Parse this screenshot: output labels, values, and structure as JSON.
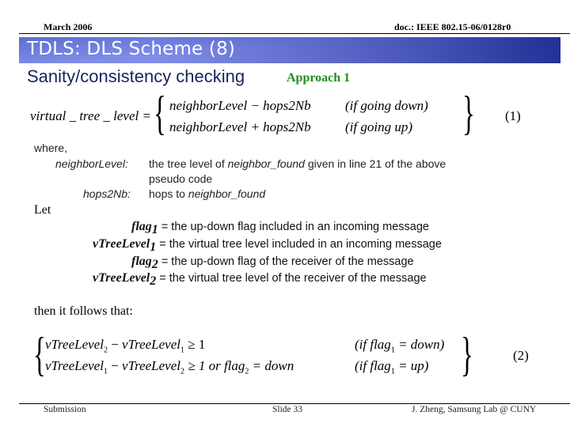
{
  "header": {
    "date": "March 2006",
    "doc_id": "doc.: IEEE 802.15-06/0128r0"
  },
  "slide": {
    "title": "TDLS: DLS Scheme (8)",
    "subtitle": "Sanity/consistency checking",
    "approach": "Approach 1"
  },
  "equation1": {
    "lhs": "virtual _ tree _ level =",
    "case1_expr": "neighborLevel − hops2Nb",
    "case1_cond": "(if  going down)",
    "case2_expr": "neighborLevel + hops2Nb",
    "case2_cond": "(if  going up)",
    "number": "(1)"
  },
  "where": {
    "label": "where,",
    "defs": [
      {
        "term": "neighborLevel:",
        "desc_pre": "the tree level of ",
        "desc_it": "neighbor_found",
        "desc_post": " given in line 21 of the above",
        "desc_cont": "pseudo code"
      },
      {
        "term": "hops2Nb:",
        "desc_pre": "hops to ",
        "desc_it": "neighbor_found",
        "desc_post": "",
        "desc_cont": ""
      }
    ]
  },
  "let": {
    "label": "Let",
    "items": [
      {
        "name": "flag",
        "sub": "1",
        "desc": "= the up-down flag included in an incoming message"
      },
      {
        "name": "vTreeLevel",
        "sub": "1",
        "desc": "= the virtual tree level included in an incoming message"
      },
      {
        "name": "flag",
        "sub": "2",
        "desc": "= the up-down flag of the receiver of the message"
      },
      {
        "name": "vTreeLevel",
        "sub": "2",
        "desc": "= the virtual tree level of the receiver of the message"
      }
    ]
  },
  "then_text": "then it follows that:",
  "equation2": {
    "row1": {
      "a": "vTreeLevel",
      "a_sub": "2",
      "op": " − ",
      "b": "vTreeLevel",
      "b_sub": "1",
      "rest": " ≥ 1",
      "cond_pre": "(if   flag",
      "cond_sub": "1",
      "cond_post": " = down)"
    },
    "row2": {
      "a": "vTreeLevel",
      "a_sub": "1",
      "op": " − ",
      "b": "vTreeLevel",
      "b_sub": "2",
      "rest": " ≥ 1  or   flag",
      "rest_sub": "2",
      "rest_post": " = down",
      "cond_pre": "(if   flag",
      "cond_sub": "1",
      "cond_post": " = up)"
    },
    "number": "(2)"
  },
  "footer": {
    "left": "Submission",
    "center": "Slide 33",
    "right": "J. Zheng, Samsung Lab @ CUNY"
  }
}
